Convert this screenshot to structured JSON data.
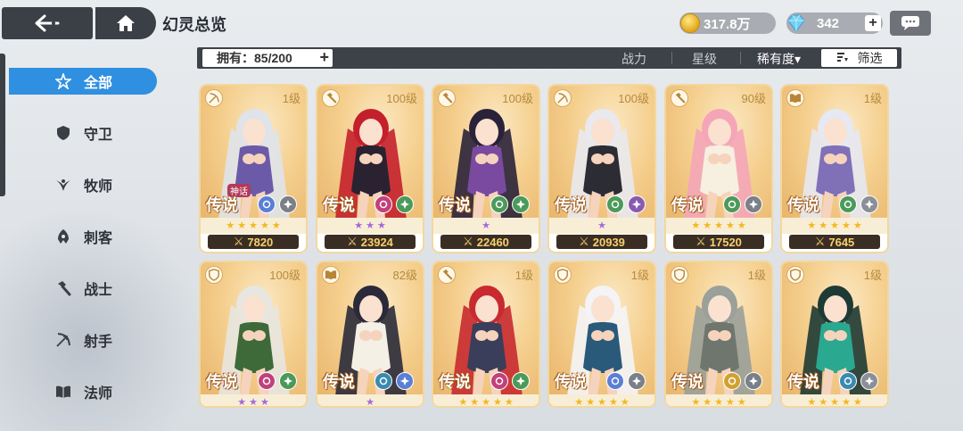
{
  "header": {
    "title": "幻灵总览",
    "gold": "317.8万",
    "gems": "342"
  },
  "filter": {
    "owned": "拥有：85/200",
    "sort": [
      "战力",
      "星级",
      "稀有度▾"
    ],
    "filter_label": "筛选"
  },
  "sidebar": {
    "items": [
      {
        "label": "全部",
        "icon": "all-icon",
        "active": true
      },
      {
        "label": "守卫",
        "icon": "shield-icon",
        "active": false
      },
      {
        "label": "牧师",
        "icon": "priest-icon",
        "active": false
      },
      {
        "label": "刺客",
        "icon": "assassin-icon",
        "active": false
      },
      {
        "label": "战士",
        "icon": "hammer-icon",
        "active": false
      },
      {
        "label": "射手",
        "icon": "bow-icon",
        "active": false
      },
      {
        "label": "法师",
        "icon": "book-icon",
        "active": false
      }
    ]
  },
  "cards": [
    {
      "level": "1级",
      "rarity": "传说",
      "myth": "神话",
      "stars": 5,
      "star_color": "gold",
      "power": "7820",
      "hair": "#dfe3ea",
      "outfit": "#6b5aa8",
      "elem": [
        "#5b7fd6",
        "#7a7f88"
      ],
      "class": "bow-icon"
    },
    {
      "level": "100级",
      "rarity": "传说",
      "myth": "",
      "stars": 3,
      "star_color": "purple",
      "power": "23924",
      "hair": "#c4202c",
      "outfit": "#2a2230",
      "elem": [
        "#c0427a",
        "#4c9a5a"
      ],
      "class": "hammer-icon"
    },
    {
      "level": "100级",
      "rarity": "传说",
      "myth": "",
      "stars": 1,
      "star_color": "purple",
      "power": "22460",
      "hair": "#2a2238",
      "outfit": "#7a4aa0",
      "elem": [
        "#4c9a5a",
        "#4c9a5a"
      ],
      "class": "hammer-icon"
    },
    {
      "level": "100级",
      "rarity": "传说",
      "myth": "",
      "stars": 1,
      "star_color": "purple",
      "power": "20939",
      "hair": "#e9e9ee",
      "outfit": "#2c2c34",
      "elem": [
        "#4c9a5a",
        "#8a5ab0"
      ],
      "class": "bow-icon"
    },
    {
      "level": "90级",
      "rarity": "传说",
      "myth": "",
      "stars": 5,
      "star_color": "gold",
      "power": "17520",
      "hair": "#f4a6b8",
      "outfit": "#f7efe0",
      "elem": [
        "#4c9a5a",
        "#7a7f88"
      ],
      "class": "hammer-icon"
    },
    {
      "level": "1级",
      "rarity": "传说",
      "myth": "",
      "stars": 5,
      "star_color": "gold",
      "power": "7645",
      "hair": "#e6e8f2",
      "outfit": "#8070b8",
      "elem": [
        "#4c9a5a",
        "#8a8f98"
      ],
      "class": "book-icon"
    },
    {
      "level": "100级",
      "rarity": "传说",
      "myth": "",
      "stars": 3,
      "star_color": "purple",
      "power": "",
      "hair": "#e8e6e0",
      "outfit": "#3e6a3a",
      "elem": [
        "#c0427a",
        "#4c9a5a"
      ],
      "class": "shield-icon"
    },
    {
      "level": "82级",
      "rarity": "传说",
      "myth": "",
      "stars": 1,
      "star_color": "purple",
      "power": "",
      "hair": "#2a2a3a",
      "outfit": "#f4f0e6",
      "elem": [
        "#3a8ab0",
        "#5b7fd6"
      ],
      "class": "book-icon"
    },
    {
      "level": "1级",
      "rarity": "传说",
      "myth": "",
      "stars": 5,
      "star_color": "gold",
      "power": "",
      "hair": "#c82a30",
      "outfit": "#3a3e5a",
      "elem": [
        "#c0427a",
        "#4c9a5a"
      ],
      "class": "hammer-icon"
    },
    {
      "level": "1级",
      "rarity": "传说",
      "myth": "",
      "stars": 5,
      "star_color": "gold",
      "power": "",
      "hair": "#f4f4f6",
      "outfit": "#2a5a7a",
      "elem": [
        "#5b7fd6",
        "#7a7f88"
      ],
      "class": "shield-icon"
    },
    {
      "level": "1级",
      "rarity": "传说",
      "myth": "",
      "stars": 5,
      "star_color": "gold",
      "power": "",
      "hair": "#9aa09a",
      "outfit": "#6e766e",
      "elem": [
        "#d2a030",
        "#7a7f88"
      ],
      "class": "shield-icon"
    },
    {
      "level": "1级",
      "rarity": "传说",
      "myth": "",
      "stars": 5,
      "star_color": "gold",
      "power": "",
      "hair": "#1e3a34",
      "outfit": "#2aa890",
      "elem": [
        "#3a8ab0",
        "#8a8f98"
      ],
      "class": "shield-icon"
    }
  ]
}
